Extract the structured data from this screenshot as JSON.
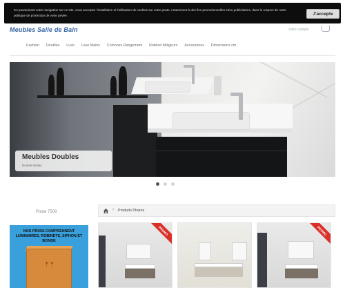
{
  "header": {
    "logo": "Meubles Salle de Bain",
    "account_label": "Votre compte"
  },
  "cookie": {
    "text": "En poursuivant votre navigation sur ce site, vous acceptez l'installation et l'utilisation de cookies sur votre poste, notamment à des fins promotionnelles et/ou publicitaires, dans le respect de notre politique de protection de votre privée.",
    "accept_label": "J'accepte"
  },
  "nav": {
    "items": [
      "Fashion",
      "Doubles",
      "Luxe",
      "Lave Mains",
      "Colonnes Rangement",
      "Robinet Mitigeurs",
      "Accessoires",
      "Dimensions cm"
    ]
  },
  "hero": {
    "title": "Meubles Doubles",
    "subtitle": "Double lavabo",
    "slides": 3,
    "active_slide": 1
  },
  "sidebar": {
    "title": "Poste 7508",
    "promo_text": "NOS PRIXIS COMPRENNENT LUMINAIRES, ROBINETS, SIPHON ET BONDE"
  },
  "breadcrumb": {
    "current": "Produits Phares"
  },
  "products": [
    {
      "ribbon": "PROMO"
    },
    {
      "ribbon": ""
    },
    {
      "ribbon": "PROMO"
    }
  ],
  "colors": {
    "logo": "#2f5f9f",
    "cookie_bg": "#0d0d0d",
    "promo_bg": "#3aa0dc",
    "ribbon": "#d9302a"
  }
}
